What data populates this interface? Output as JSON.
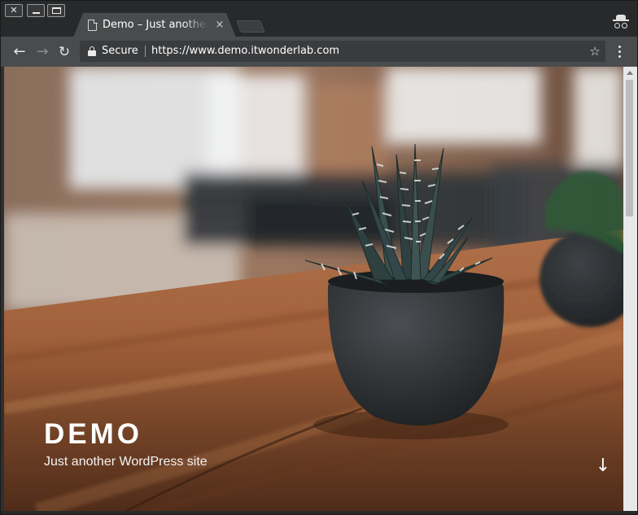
{
  "window": {
    "close_glyph": "✕",
    "minimize_label": "",
    "maximize_label": ""
  },
  "tab": {
    "title": "Demo – Just another WordPress site",
    "close_glyph": "×"
  },
  "toolbar": {
    "back_glyph": "←",
    "forward_glyph": "→",
    "reload_glyph": "↻",
    "security_label": "Secure",
    "url": "https://www.demo.itwonderlab.com",
    "star_glyph": "☆"
  },
  "page": {
    "site_title": "DEMO",
    "site_description": "Just another WordPress site",
    "scroll_glyph": "↓"
  },
  "icons": {
    "tab_page": "document-icon",
    "incognito": "incognito-icon",
    "lock": "lock-icon",
    "menu": "kebab-menu-icon"
  },
  "colors": {
    "tab_active": "#4a4b4d",
    "toolbar": "#4a4b4d",
    "omnibox": "#3a3b3d",
    "titlebar": "#28292b",
    "hero_text": "#ffffff"
  }
}
